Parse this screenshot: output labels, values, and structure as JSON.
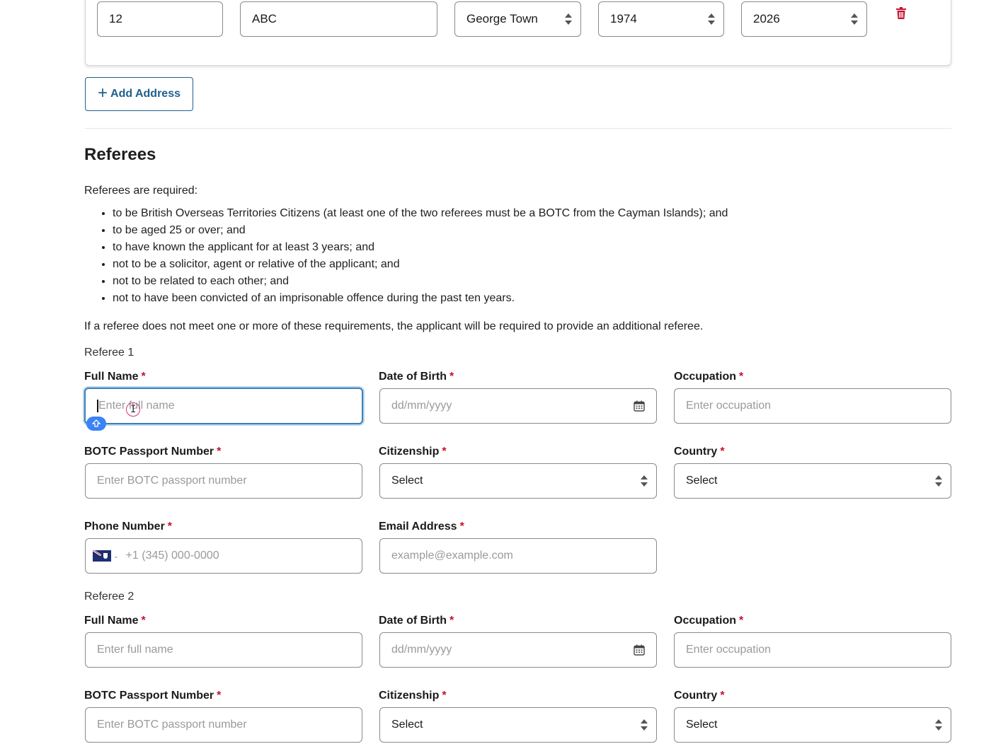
{
  "address_row": {
    "house_number": "12",
    "street": "ABC",
    "district": "George Town",
    "from_year": "1974",
    "to_year": "2026",
    "delete_icon": "trash-icon"
  },
  "add_address": {
    "label": "Add Address",
    "icon": "plus-icon"
  },
  "referees": {
    "title": "Referees",
    "intro": "Referees are required:",
    "requirements": [
      "to be British Overseas Territories Citizens (at least one of the two referees must be a BOTC from the Cayman Islands); and",
      "to be aged 25 or over; and",
      "to have known the applicant for at least 3 years; and",
      "not to be a solicitor, agent or relative of the applicant; and",
      "not to be related to each other; and",
      "not to have been convicted of an imprisonable offence during the past ten years."
    ],
    "note": "If a referee does not meet one or more of these requirements, the applicant will be required to provide an additional referee."
  },
  "labels": {
    "required_mark": "*",
    "full_name": "Full Name",
    "dob": "Date of Birth",
    "occupation": "Occupation",
    "passport": "BOTC Passport Number",
    "citizenship": "Citizenship",
    "country": "Country",
    "phone": "Phone Number",
    "email": "Email Address"
  },
  "placeholders": {
    "full_name": "Enter full name",
    "dob": "dd/mm/yyyy",
    "occupation": "Enter occupation",
    "passport": "Enter BOTC passport number",
    "select": "Select",
    "phone": "+1 (345) 000-0000",
    "email": "example@example.com"
  },
  "referee1": {
    "title": "Referee 1"
  },
  "referee2": {
    "title": "Referee 2"
  },
  "colors": {
    "accent": "#1f5f8b",
    "required": "#c8102e",
    "focus": "#3f7fb8"
  }
}
